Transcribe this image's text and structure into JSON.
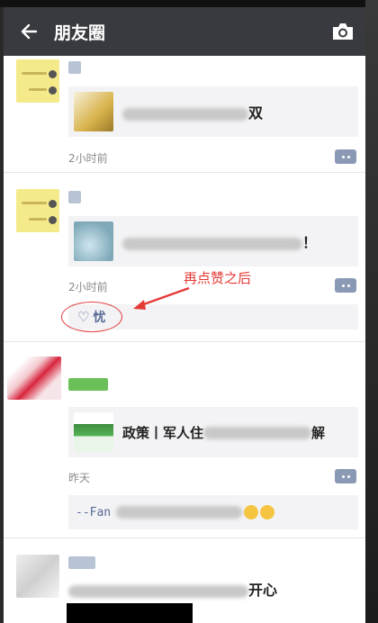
{
  "header": {
    "title": "朋友圈",
    "back_icon": "back-arrow-icon",
    "camera_icon": "camera-icon"
  },
  "posts": [
    {
      "share_text": "双",
      "time": "2小时前"
    },
    {
      "share_text": "！",
      "time": "2小时前",
      "likes": [
        {
          "name": "忧"
        }
      ]
    },
    {
      "share_text_start": "政策丨军人住",
      "share_text_end": "解",
      "time": "昨天",
      "comment_prefix": "--Fan"
    },
    {
      "share_text": "开心"
    }
  ],
  "annotation": {
    "text": "再点赞之后",
    "color": "#e53935"
  },
  "colors": {
    "title_bar": "#393a3f",
    "link_blue": "#576b95",
    "share_bg": "#f3f3f5"
  }
}
